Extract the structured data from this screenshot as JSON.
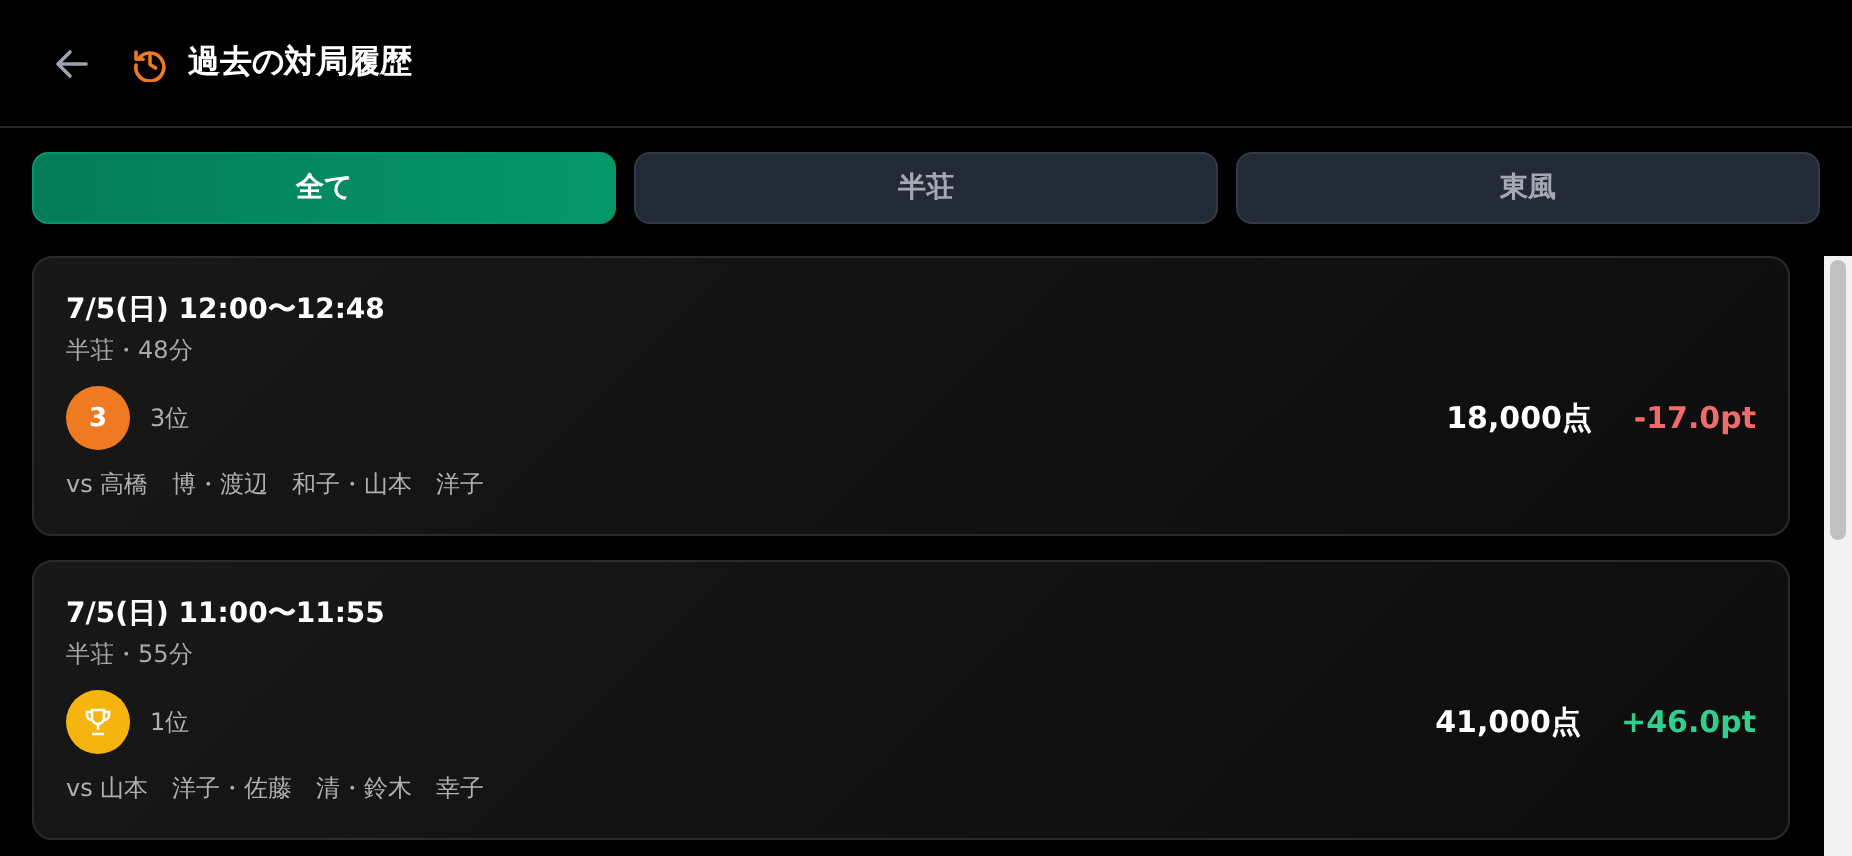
{
  "header": {
    "title": "過去の対局履歴"
  },
  "tabs": [
    {
      "label": "全て",
      "selected": true
    },
    {
      "label": "半荘",
      "selected": false
    },
    {
      "label": "東風",
      "selected": false
    }
  ],
  "games": [
    {
      "time": "7/5(日) 12:00〜12:48",
      "meta": "半荘・48分",
      "badge": {
        "kind": "rank",
        "label": "3",
        "color": "#f07a22"
      },
      "rank": "3位",
      "score": "18,000点",
      "pt": "-17.0pt",
      "color": "#f26b6b",
      "opponents": "vs 高橋　博・渡辺　和子・山本　洋子"
    },
    {
      "time": "7/5(日) 11:00〜11:55",
      "meta": "半荘・55分",
      "badge": {
        "kind": "trophy",
        "color": "#f5b40e"
      },
      "rank": "1位",
      "score": "41,000点",
      "pt": "+46.0pt",
      "color": "#2fd08f",
      "opponents": "vs 山本　洋子・佐藤　清・鈴木　幸子"
    }
  ]
}
